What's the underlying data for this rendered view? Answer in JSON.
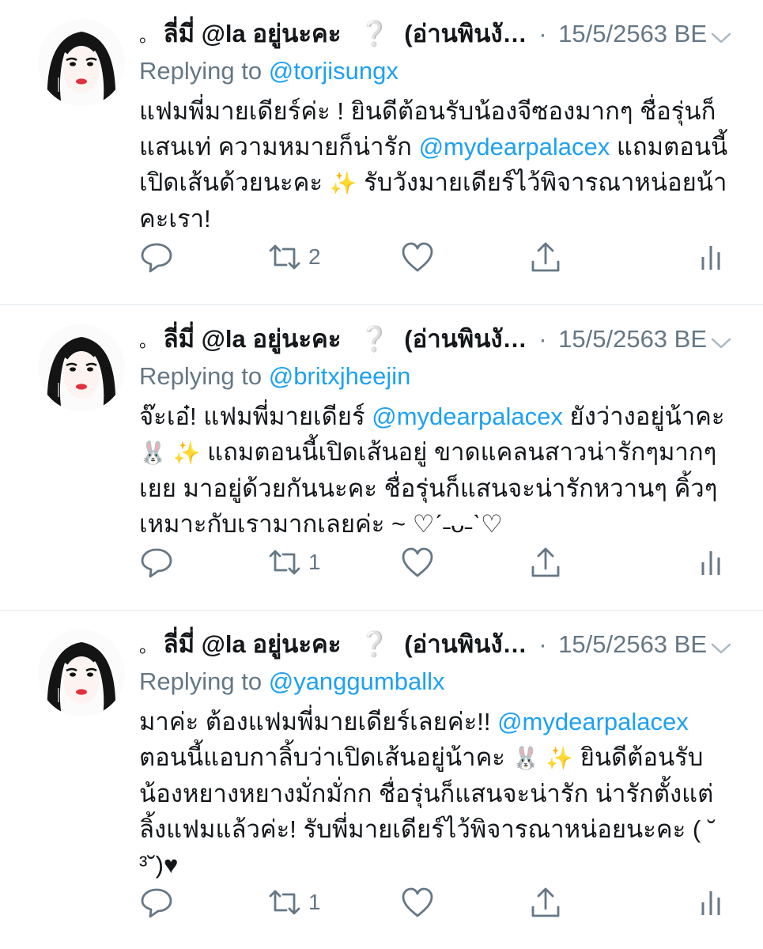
{
  "colors": {
    "link": "#1da1f2",
    "muted": "#657786",
    "divider": "#e1e8ed"
  },
  "tweets": [
    {
      "prefix": "。",
      "name": "ลี่มี่ @la อยู่นะคะ",
      "mark": "❔",
      "name2": "(อ่านพินงั…",
      "sep": "·",
      "date": "15/5/2563 BE",
      "reply_prefix": "Replying to",
      "reply_handle": "@torjisungx",
      "body": {
        "p1": "แฟมพี่มายเดียร์ค่ะ ! ยินดีต้อนรับน้องจีซองมากๆ ชื่อรุ่นก็แสนเท่ ความหมายก็น่ารัก ",
        "mention": "@mydearpalacex",
        "p2": "  แถมตอนนี้เปิดเส้นด้วยนะคะ ",
        "emoji": "✨",
        "p3": " รับวังมายเดียร์ไว้พิจารณาหน่อยน้าคะเรา!"
      },
      "retweet_count": "2",
      "icons": [
        "reply-icon",
        "retweet-icon",
        "like-icon",
        "share-icon",
        "analytics-icon"
      ]
    },
    {
      "prefix": "。",
      "name": "ลี่มี่ @la อยู่นะคะ",
      "mark": "❔",
      "name2": "(อ่านพินงั…",
      "sep": "·",
      "date": "15/5/2563 BE",
      "reply_prefix": "Replying to",
      "reply_handle": "@britxjheejin",
      "body": {
        "p1": "จ๊ะเอ๋! แฟมพี่มายเดียร์ ",
        "mention": "@mydearpalacex",
        "p2": "  ยังว่างอยู่น้าคะ ",
        "emoji": "🐰 ✨",
        "p3": "  แถมตอนนี้เปิดเส้นอยู่ ขาดแคลนสาวน่ารักๆมากๆเยย มาอยู่ด้วยกันนะคะ ชื่อรุ่นก็แสนจะน่ารักหวานๆ คิ้วๆ เหมาะกับเรามากเลยค่ะ ~ ♡ˊ˗ᴗ˗ˋ♡"
      },
      "retweet_count": "1",
      "icons": [
        "reply-icon",
        "retweet-icon",
        "like-icon",
        "share-icon",
        "analytics-icon"
      ]
    },
    {
      "prefix": "。",
      "name": "ลี่มี่ @la อยู่นะคะ",
      "mark": "❔",
      "name2": "(อ่านพินงั…",
      "sep": "·",
      "date": "15/5/2563 BE",
      "reply_prefix": "Replying to",
      "reply_handle": "@yanggumballx",
      "body": {
        "p1": "มาค่ะ ต้องแฟมพี่มายเดียร์เลยค่ะ!! ",
        "mention": "@mydearpalacex",
        "p2": " ตอนนี้แอบกาลิ้บว่าเปิดเส้นอยู่น้าคะ ",
        "emoji": "🐰 ✨",
        "p3": "  ยินดีต้อนรับน้องหยางหยางมั่กมั่กก ชื่อรุ่นก็แสนจะน่ารัก น่ารักตั้งแต่ลิ้งแฟมแล้วค่ะ! รับพี่มายเดียร์ไว้พิจารณาหน่อยนะคะ ( ˘ ³˘)♥"
      },
      "retweet_count": "1",
      "icons": [
        "reply-icon",
        "retweet-icon",
        "like-icon",
        "share-icon",
        "analytics-icon"
      ]
    }
  ]
}
